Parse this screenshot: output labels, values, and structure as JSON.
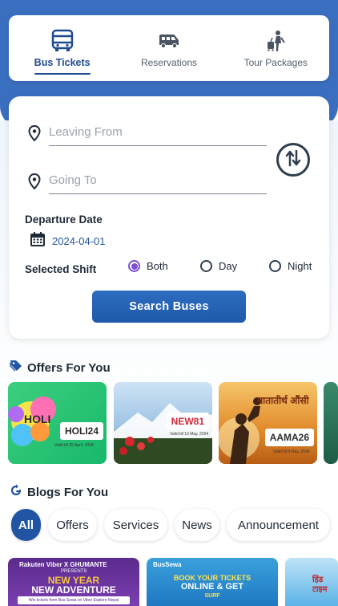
{
  "tabs": [
    {
      "label": "Bus Tickets",
      "icon": "bus-icon",
      "active": true
    },
    {
      "label": "Reservations",
      "icon": "van-icon",
      "active": false
    },
    {
      "label": "Tour Packages",
      "icon": "traveler-icon",
      "active": false
    }
  ],
  "search": {
    "leaving_placeholder": "Leaving From",
    "going_placeholder": "Going To",
    "departure_label": "Departure Date",
    "date_value": "2024-04-01",
    "shift_label": "Selected Shift",
    "shift_options": [
      "Both",
      "Day",
      "Night"
    ],
    "selected_shift": "Both",
    "button_label": "Search Buses"
  },
  "offers": {
    "heading": "Offers For You",
    "items": [
      {
        "code": "HOLI24",
        "art_text": "HOLI",
        "valid": "Valid till 25 April, 2024"
      },
      {
        "code": "NEW81",
        "valid": "Valid till 13 May, 2024"
      },
      {
        "code": "AAMA26",
        "art_text": "मातातीर्थ औंसी",
        "valid": "Valid till 8 May, 2024"
      }
    ]
  },
  "blogs": {
    "heading": "Blogs For You",
    "categories": [
      "All",
      "Offers",
      "Services",
      "News",
      "Announcement"
    ],
    "active_category": "All",
    "items": [
      {
        "brand": "Rakuten Viber X GHUMANTE",
        "sub": "PRESENTS",
        "line1": "NEW YEAR",
        "line2": "NEW ADVENTURE",
        "caption": "Win tickets from Bus Sewa on Viber Explore Nepal"
      },
      {
        "brand": "BusSewa",
        "line1": "BOOK YOUR TICKETS",
        "line2": "ONLINE & GET",
        "line3": "SURF"
      },
      {
        "art_text": "हिंड टाइम"
      }
    ]
  },
  "colors": {
    "primary": "#2154a3",
    "header_bg": "#3a6fc0",
    "radio_accent": "#7c4dd6"
  }
}
